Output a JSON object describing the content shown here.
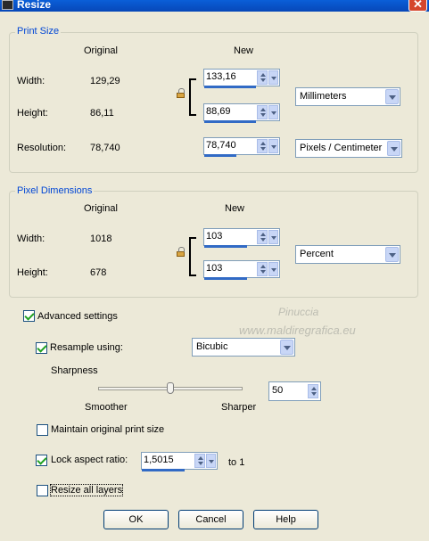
{
  "window": {
    "title": "Resize"
  },
  "print_size": {
    "title": "Print Size",
    "col_original": "Original",
    "col_new": "New",
    "width_label": "Width:",
    "width_original": "129,29",
    "width_new": "133,16",
    "height_label": "Height:",
    "height_original": "86,11",
    "height_new": "88,69",
    "resolution_label": "Resolution:",
    "resolution_original": "78,740",
    "resolution_new": "78,740",
    "units_select": "Millimeters",
    "resolution_units_select": "Pixels / Centimeter"
  },
  "pixel_dimensions": {
    "title": "Pixel Dimensions",
    "col_original": "Original",
    "col_new": "New",
    "width_label": "Width:",
    "width_original": "1018",
    "width_new": "103",
    "height_label": "Height:",
    "height_original": "678",
    "height_new": "103",
    "units_select": "Percent"
  },
  "advanced": {
    "advanced_settings_label": "Advanced settings",
    "advanced_settings_checked": true,
    "resample_label": "Resample using:",
    "resample_checked": true,
    "resample_method": "Bicubic",
    "sharpness_label": "Sharpness",
    "sharpness_value": "50",
    "sharpness_level": 50,
    "smoother_label": "Smoother",
    "sharper_label": "Sharper",
    "maintain_print_size_label": "Maintain original print size",
    "maintain_print_size_checked": false,
    "lock_aspect_label": "Lock aspect ratio:",
    "lock_aspect_checked": true,
    "aspect_ratio_value": "1,5015",
    "aspect_to_label": "to 1",
    "resize_all_layers_label": "Resize all layers",
    "resize_all_layers_checked": false
  },
  "watermark": {
    "line1": "Pinuccia",
    "line2": "www.maldiregrafica.eu"
  },
  "buttons": {
    "ok": "OK",
    "cancel": "Cancel",
    "help": "Help"
  },
  "colors": {
    "titlebar": "#0a5fd8",
    "group_title": "#0046d5",
    "accent_bar": "#316ac5",
    "background": "#ece9d8"
  }
}
